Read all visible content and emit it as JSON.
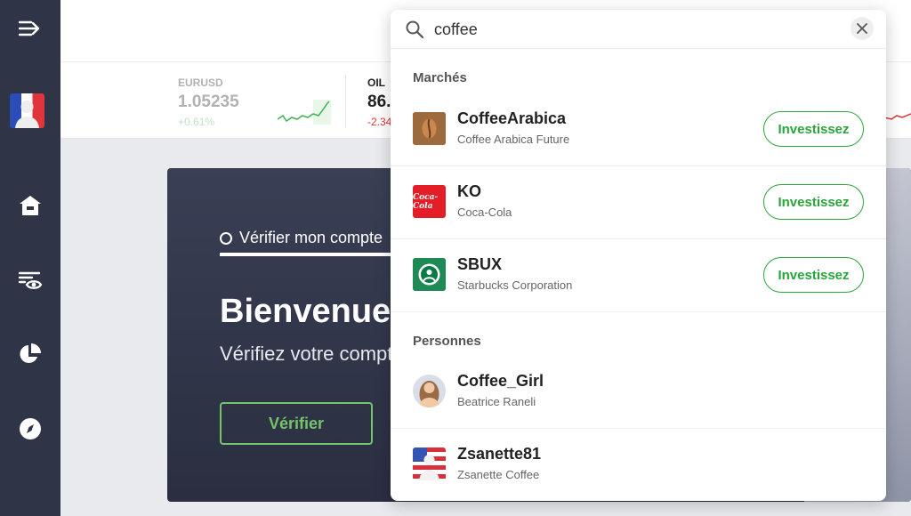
{
  "tickers": [
    {
      "name": "EURUSD",
      "price": "1.05235",
      "change": "+0.61%"
    },
    {
      "name": "OIL",
      "price": "86.",
      "change": "-2.34"
    }
  ],
  "welcome": {
    "step_label": "Vérifier mon compte",
    "title": "Bienvenue",
    "subtitle": "Vérifiez votre compte",
    "verify_button": "Vérifier"
  },
  "search": {
    "query": "coffee",
    "markets_title": "Marchés",
    "people_title": "Personnes",
    "invest_label": "Investissez",
    "markets": [
      {
        "symbol": "CoffeeArabica",
        "name": "Coffee Arabica Future",
        "icon": "coffee-bean-icon",
        "color": "#8b5a2b"
      },
      {
        "symbol": "KO",
        "name": "Coca-Cola",
        "icon": "coca-cola-logo",
        "color": "#e41e26",
        "logo_text": "Coca-Cola"
      },
      {
        "symbol": "SBUX",
        "name": "Starbucks Corporation",
        "icon": "starbucks-logo",
        "color": "#0b7a45"
      }
    ],
    "people": [
      {
        "username": "Coffee_Girl",
        "name": "Beatrice Raneli",
        "icon": "user-photo-avatar"
      },
      {
        "username": "Zsanette81",
        "name": "Zsanette Coffee",
        "icon": "flag-avatar"
      }
    ]
  },
  "colors": {
    "sidebar": "#2f3447",
    "accent_green": "#2aa53a",
    "verify_green": "#75c36a",
    "negative": "#e0353a",
    "positive": "#3fb34f"
  }
}
